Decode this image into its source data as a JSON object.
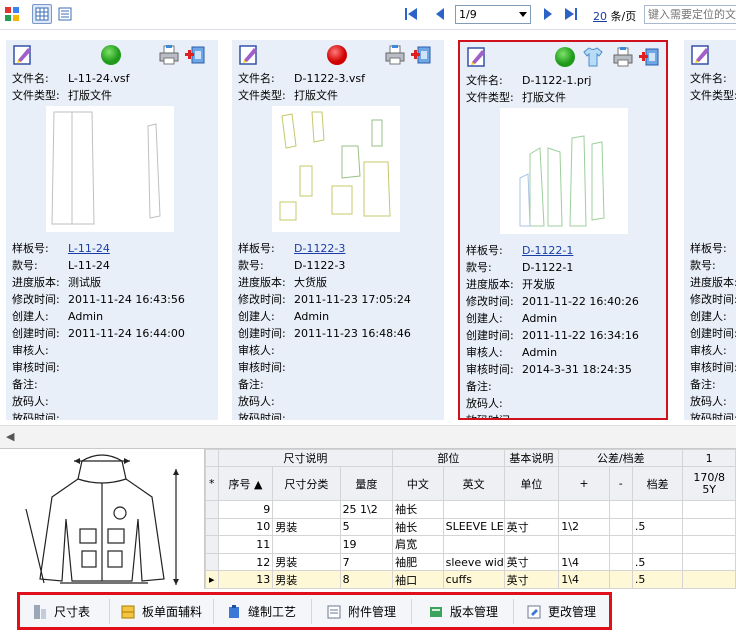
{
  "toolbar": {
    "page_value": "1/9",
    "per_page_count": "20",
    "per_page_unit": "条/页",
    "locate_placeholder": "键入需要定位的文"
  },
  "labels": {
    "filename": "文件名:",
    "filetype": "文件类型:",
    "sample_no": "样板号:",
    "style_no": "款号:",
    "progress": "进度版本:",
    "modified": "修改时间:",
    "creator": "创建人:",
    "created": "创建时间:",
    "reviewer": "审核人:",
    "reviewed": "审核时间:",
    "note": "备注:",
    "grader": "放码人:",
    "graded": "放码时间:"
  },
  "cards": [
    {
      "filename": "L-11-24.vsf",
      "filetype": "打版文件",
      "sample_no": "L-11-24",
      "style_no": "L-11-24",
      "progress": "测试版",
      "modified": "2011-11-24 16:43:56",
      "creator": "Admin",
      "created": "2011-11-24 16:44:00",
      "reviewer": "",
      "reviewed": "",
      "note": "",
      "grader": "",
      "graded": "",
      "status": "green"
    },
    {
      "filename": "D-1122-3.vsf",
      "filetype": "打版文件",
      "sample_no": "D-1122-3",
      "style_no": "D-1122-3",
      "progress": "大货版",
      "modified": "2011-11-23 17:05:24",
      "creator": "Admin",
      "created": "2011-11-23 16:48:46",
      "reviewer": "",
      "reviewed": "",
      "note": "",
      "grader": "",
      "graded": "",
      "status": "red"
    },
    {
      "filename": "D-1122-1.prj",
      "filetype": "打版文件",
      "sample_no": "D-1122-1",
      "style_no": "D-1122-1",
      "progress": "开发版",
      "modified": "2011-11-22 16:40:26",
      "creator": "Admin",
      "created": "2011-11-22 16:34:16",
      "reviewer": "Admin",
      "reviewed": "2014-3-31 18:24:35",
      "note": "",
      "grader": "",
      "graded": "",
      "status": "green"
    },
    {
      "filename": "",
      "filetype": "",
      "sample_no": "",
      "style_no": "",
      "progress": "",
      "modified": "",
      "creator": "",
      "created": "",
      "reviewer": "",
      "reviewed": "",
      "note": "",
      "grader": "",
      "graded": "",
      "status": ""
    }
  ],
  "grid": {
    "group_headers": [
      "尺寸说明",
      "部位",
      "基本说明",
      "公差/档差",
      "1"
    ],
    "columns": [
      "序号",
      "尺寸分类",
      "量度",
      "中文",
      "英文",
      "单位",
      "+",
      "-",
      "档差",
      "170/8\n5Y"
    ],
    "rows": [
      [
        "9",
        "",
        "25 1\\2",
        "袖长",
        "",
        "",
        "",
        "",
        "",
        ""
      ],
      [
        "10",
        "男装",
        "5",
        "袖长",
        "SLEEVE LEN",
        "英寸",
        "1\\2",
        "",
        ".5",
        ""
      ],
      [
        "11",
        "",
        "19",
        "肩宽",
        "",
        "",
        "",
        "",
        "",
        ""
      ],
      [
        "12",
        "男装",
        "7",
        "袖肥",
        "sleeve widtl",
        "英寸",
        "1\\4",
        "",
        ".5",
        ""
      ],
      [
        "13",
        "男装",
        "8",
        "袖口",
        "cuffs",
        "英寸",
        "1\\4",
        "",
        ".5",
        ""
      ]
    ]
  },
  "tabs": [
    "尺寸表",
    "板单面辅料",
    "缝制工艺",
    "附件管理",
    "版本管理",
    "更改管理"
  ]
}
